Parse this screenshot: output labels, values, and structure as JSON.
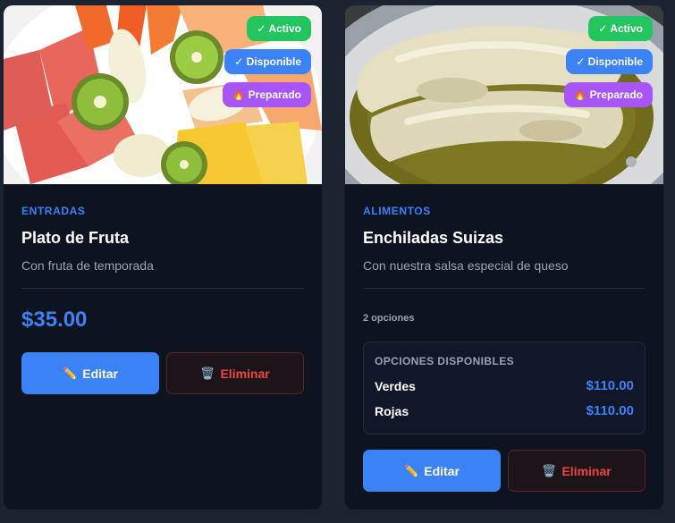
{
  "colors": {
    "background": "#1b2230",
    "card": "#0e1320",
    "accent": "#3b82f6",
    "badge_active": "#22c55e",
    "badge_available": "#3b82f6",
    "badge_prepared": "#a855f7",
    "delete": "#ef4444"
  },
  "products": [
    {
      "image_icon": "fruit-plate-photo",
      "badges": {
        "active": "✓ Activo",
        "available": "✓ Disponible",
        "prepared": "Preparado",
        "prepared_icon": "fire-icon"
      },
      "category": "ENTRADAS",
      "name": "Plato de Fruta",
      "description": "Con fruta de temporada",
      "price": "$35.00",
      "edit_label": "Editar",
      "edit_icon": "pencil-icon",
      "delete_label": "Eliminar",
      "delete_icon": "trash-icon"
    },
    {
      "image_icon": "enchiladas-photo",
      "badges": {
        "active": "✓ Activo",
        "available": "✓ Disponible",
        "prepared": "Preparado",
        "prepared_icon": "fire-icon"
      },
      "category": "ALIMENTOS",
      "name": "Enchiladas Suizas",
      "description": "Con nuestra salsa especial de queso",
      "options_count": "2 opciones",
      "options_heading": "OPCIONES DISPONIBLES",
      "options": [
        {
          "name": "Verdes",
          "price": "$110.00"
        },
        {
          "name": "Rojas",
          "price": "$110.00"
        }
      ],
      "edit_label": "Editar",
      "edit_icon": "pencil-icon",
      "delete_label": "Eliminar",
      "delete_icon": "trash-icon"
    }
  ]
}
